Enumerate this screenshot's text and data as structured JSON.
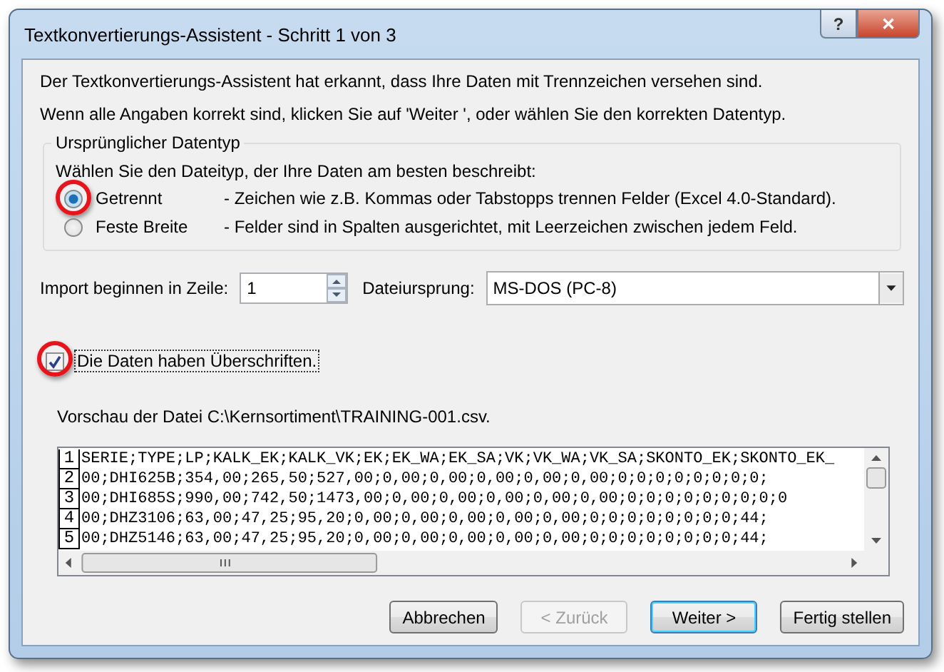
{
  "window": {
    "title": "Textkonvertierungs-Assistent - Schritt 1 von 3",
    "help_label": "?",
    "close_label": "✕"
  },
  "intro": [
    "Der Textkonvertierungs-Assistent hat erkannt, dass Ihre Daten mit Trennzeichen versehen sind.",
    "Wenn alle Angaben korrekt sind, klicken Sie auf 'Weiter ', oder wählen Sie den korrekten Datentyp."
  ],
  "data_type_group": {
    "title": "Ursprünglicher Datentyp",
    "prompt": "Wählen Sie den Dateityp, der Ihre Daten am besten beschreibt:",
    "options": [
      {
        "label": "Getrennt",
        "description": "- Zeichen wie z.B. Kommas oder Tabstopps trennen Felder (Excel 4.0-Standard).",
        "selected": true,
        "highlighted": true
      },
      {
        "label": "Feste Breite",
        "description": "- Felder sind in Spalten ausgerichtet, mit Leerzeichen zwischen jedem Feld.",
        "selected": false,
        "highlighted": false
      }
    ]
  },
  "start_row": {
    "label": "Import beginnen in Zeile:",
    "value": "1"
  },
  "origin": {
    "label": "Dateiursprung:",
    "value": "MS-DOS (PC-8)"
  },
  "headers_checkbox": {
    "label": "Die Daten haben Überschriften.",
    "checked": true,
    "highlighted": true
  },
  "preview": {
    "title": "Vorschau der Datei C:\\Kernsortiment\\TRAINING-001.csv.",
    "rows": [
      {
        "number": "1",
        "text": "SERIE;TYPE;LP;KALK_EK;KALK_VK;EK;EK_WA;EK_SA;VK;VK_WA;VK_SA;SKONTO_EK;SKONTO_EK_"
      },
      {
        "number": "2",
        "text": "00;DHI625B;354,00;265,50;527,00;0,00;0,00;0,00;0,00;0,00;0;0;0;0;0;0;0;0;"
      },
      {
        "number": "3",
        "text": "00;DHI685S;990,00;742,50;1473,00;0,00;0,00;0,00;0,00;0,00;0;0;0;0;0;0;0;0;0"
      },
      {
        "number": "4",
        "text": "00;DHZ3106;63,00;47,25;95,20;0,00;0,00;0,00;0,00;0,00;0;0;0;0;0;0;0;0;44;"
      },
      {
        "number": "5",
        "text": "00;DHZ5146;63,00;47,25;95,20;0,00;0,00;0,00;0,00;0,00;0;0;0;0;0;0;0;0;44;"
      }
    ]
  },
  "buttons": [
    {
      "label": "Abbrechen",
      "disabled": false,
      "default": false
    },
    {
      "label": "< Zurück",
      "disabled": true,
      "default": false
    },
    {
      "label": "Weiter >",
      "disabled": false,
      "default": true
    },
    {
      "label": "Fertig stellen",
      "disabled": false,
      "default": false
    }
  ]
}
